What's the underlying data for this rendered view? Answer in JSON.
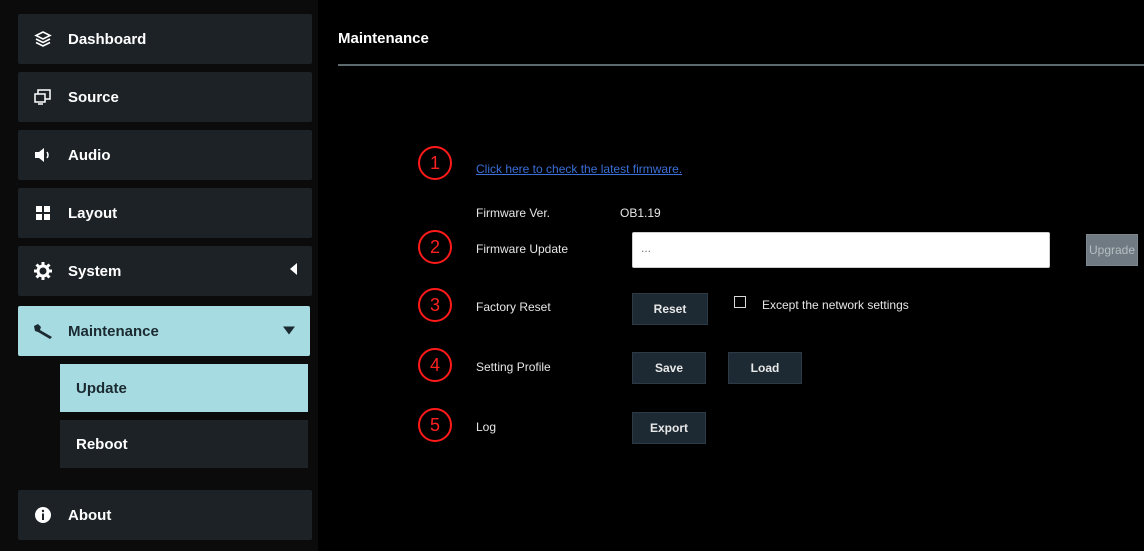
{
  "sidebar": {
    "items": [
      {
        "label": "Dashboard",
        "icon": "layers-icon"
      },
      {
        "label": "Source",
        "icon": "monitor-icon"
      },
      {
        "label": "Audio",
        "icon": "speaker-icon"
      },
      {
        "label": "Layout",
        "icon": "grid-icon"
      },
      {
        "label": "System",
        "icon": "gear-icon"
      },
      {
        "label": "Maintenance",
        "icon": "wrench-icon"
      },
      {
        "label": "About",
        "icon": "info-icon"
      }
    ],
    "subitems": [
      {
        "label": "Update"
      },
      {
        "label": "Reboot"
      }
    ]
  },
  "main": {
    "title": "Maintenance",
    "check_link": "Click here to check the latest firmware.",
    "firmware_ver_label": "Firmware Ver.",
    "firmware_ver_value": "OB1.19",
    "firmware_update_label": "Firmware Update",
    "firmware_update_placeholder": "...",
    "upgrade_label": "Upgrade",
    "factory_reset_label": "Factory Reset",
    "reset_label": "Reset",
    "except_network_label": "Except the network settings",
    "setting_profile_label": "Setting Profile",
    "save_label": "Save",
    "load_label": "Load",
    "log_label": "Log",
    "export_label": "Export",
    "callouts": [
      "1",
      "2",
      "3",
      "4",
      "5"
    ]
  },
  "colors": {
    "active": "#a7dbe2",
    "nav_bg": "#1c2226",
    "callout": "#ff1a1a",
    "link": "#3b6fd8"
  }
}
